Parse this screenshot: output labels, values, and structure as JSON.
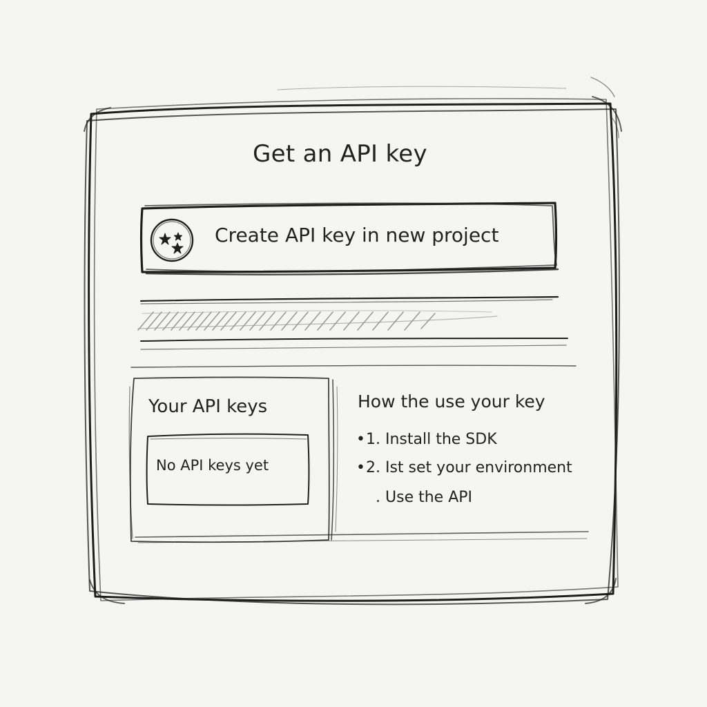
{
  "dialog": {
    "title": "Get an API key"
  },
  "create_button": {
    "label": "Create API key in new project",
    "icon": "sparkle-stars-icon"
  },
  "keys_panel": {
    "heading": "Your API keys",
    "empty_state": "No API keys yet"
  },
  "usage_panel": {
    "heading": "How the use your key",
    "steps": [
      {
        "bullet": "•",
        "text": "1. Install the SDK"
      },
      {
        "bullet": "•",
        "text": "2. Ist set your environment"
      },
      {
        "bullet": ".",
        "text": "Use the API"
      }
    ]
  },
  "colors": {
    "background": "#f5f5f4",
    "ink": "#1e1e1e",
    "hatch": "#8a8a8a"
  }
}
